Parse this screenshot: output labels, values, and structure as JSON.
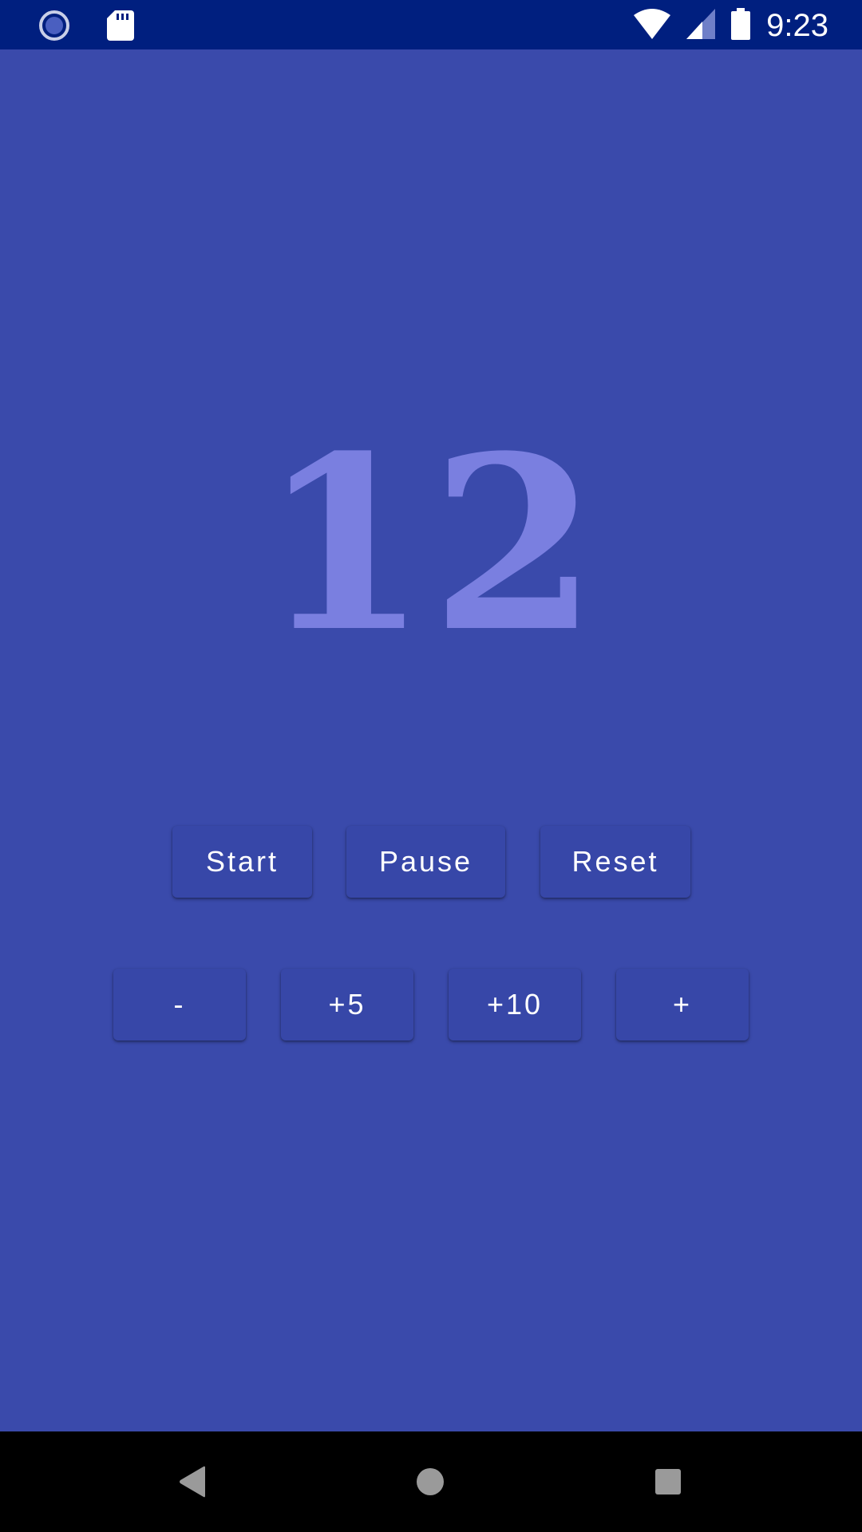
{
  "status_bar": {
    "time": "9:23",
    "icons": [
      "sync-icon",
      "sd-card-icon",
      "wifi-icon",
      "cellular-signal-icon",
      "battery-icon"
    ]
  },
  "counter": {
    "value": "12",
    "color": "#7a7fe0"
  },
  "controls": {
    "start_label": "Start",
    "pause_label": "Pause",
    "reset_label": "Reset"
  },
  "adjust": {
    "minus_label": "-",
    "plus5_label": "+5",
    "plus10_label": "+10",
    "plus_label": "+"
  },
  "nav_bar": {
    "icons": [
      "back-icon",
      "home-icon",
      "recents-icon"
    ]
  },
  "colors": {
    "background": "#3a4aab",
    "status_bar": "#001f7f",
    "button": "#3747a8",
    "nav_bar": "#000000"
  }
}
